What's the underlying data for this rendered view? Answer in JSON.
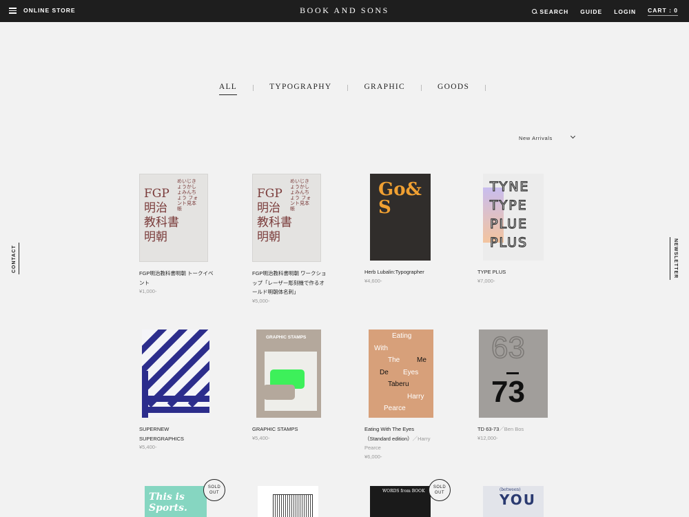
{
  "header": {
    "store_label": "ONLINE STORE",
    "brand": "BOOK AND SONS",
    "search": "SEARCH",
    "guide": "GUIDE",
    "login": "LOGIN",
    "cart": "CART : 0"
  },
  "tabs": [
    {
      "label": "ALL",
      "active": true
    },
    {
      "label": "TYPOGRAPHY",
      "active": false
    },
    {
      "label": "GRAPHIC",
      "active": false
    },
    {
      "label": "GOODS",
      "active": false
    }
  ],
  "sort": {
    "selected": "New Arrivals"
  },
  "side": {
    "contact": "CONTACT",
    "newsletter": "NEWSLETTER"
  },
  "products": [
    {
      "title": "FGP明治教科書明朝 トークイベント",
      "price": "¥1,000-",
      "cover_text": "FGP\n明治\n教科書\n明朝",
      "cover_sub": "めいじきょうかしょみんちょう フォント見本帳"
    },
    {
      "title": "FGP明治教科書明朝 ワークショップ「レーザー彫刻機で作るオールド明朝体名刺」",
      "price": "¥5,000-",
      "cover_text": "FGP\n明治\n教科書\n明朝",
      "cover_sub": "めいじきょうかしょみんちょう フォント見本帳"
    },
    {
      "title": "Herb Lubalin:Typographer",
      "price": "¥4,600-",
      "cover_text": "Go&S"
    },
    {
      "title": "TYPE PLUS",
      "price": "¥7,000-",
      "cover_text": "TYNE\nTYPE\nPLUE\nPLUS"
    },
    {
      "title": "SUPERNEW SUPERGRAPHICS",
      "price": "¥5,400-"
    },
    {
      "title": "GRAPHIC STAMPS",
      "price": "¥5,400-",
      "cover_text": "GRAPHIC STAMPS"
    },
    {
      "title": "Eating With The Eyes（Standard edition）",
      "author": "／Harry Pearce",
      "price": "¥6,000-",
      "cover_words": [
        "Eating",
        "With",
        "The",
        "Me",
        "De",
        "Eyes",
        "Taberu",
        "Harry",
        "Pearce"
      ]
    },
    {
      "title": "TD 63-73",
      "author": "／Ben Bos",
      "price": "¥12,000-",
      "cover_top": "63",
      "cover_bottom": "73"
    },
    {
      "title": "This is Sports",
      "sold_out": "SOLD OUT",
      "cover_text": "This is Sports."
    },
    {
      "title": "",
      "cover_text": ""
    },
    {
      "title": "",
      "sold_out": "SOLD OUT",
      "cover_text": "WORDS from BOOK"
    },
    {
      "title": "",
      "cover_text": "YOU",
      "cover_sub": "(between)"
    }
  ],
  "icons": {
    "menu": "hamburger-icon",
    "search": "search-icon",
    "sort": "chevron-down-icon"
  },
  "colors": {
    "header_bg": "#1e1e1e",
    "page_bg": "#f2f2f2",
    "price": "#999999"
  }
}
